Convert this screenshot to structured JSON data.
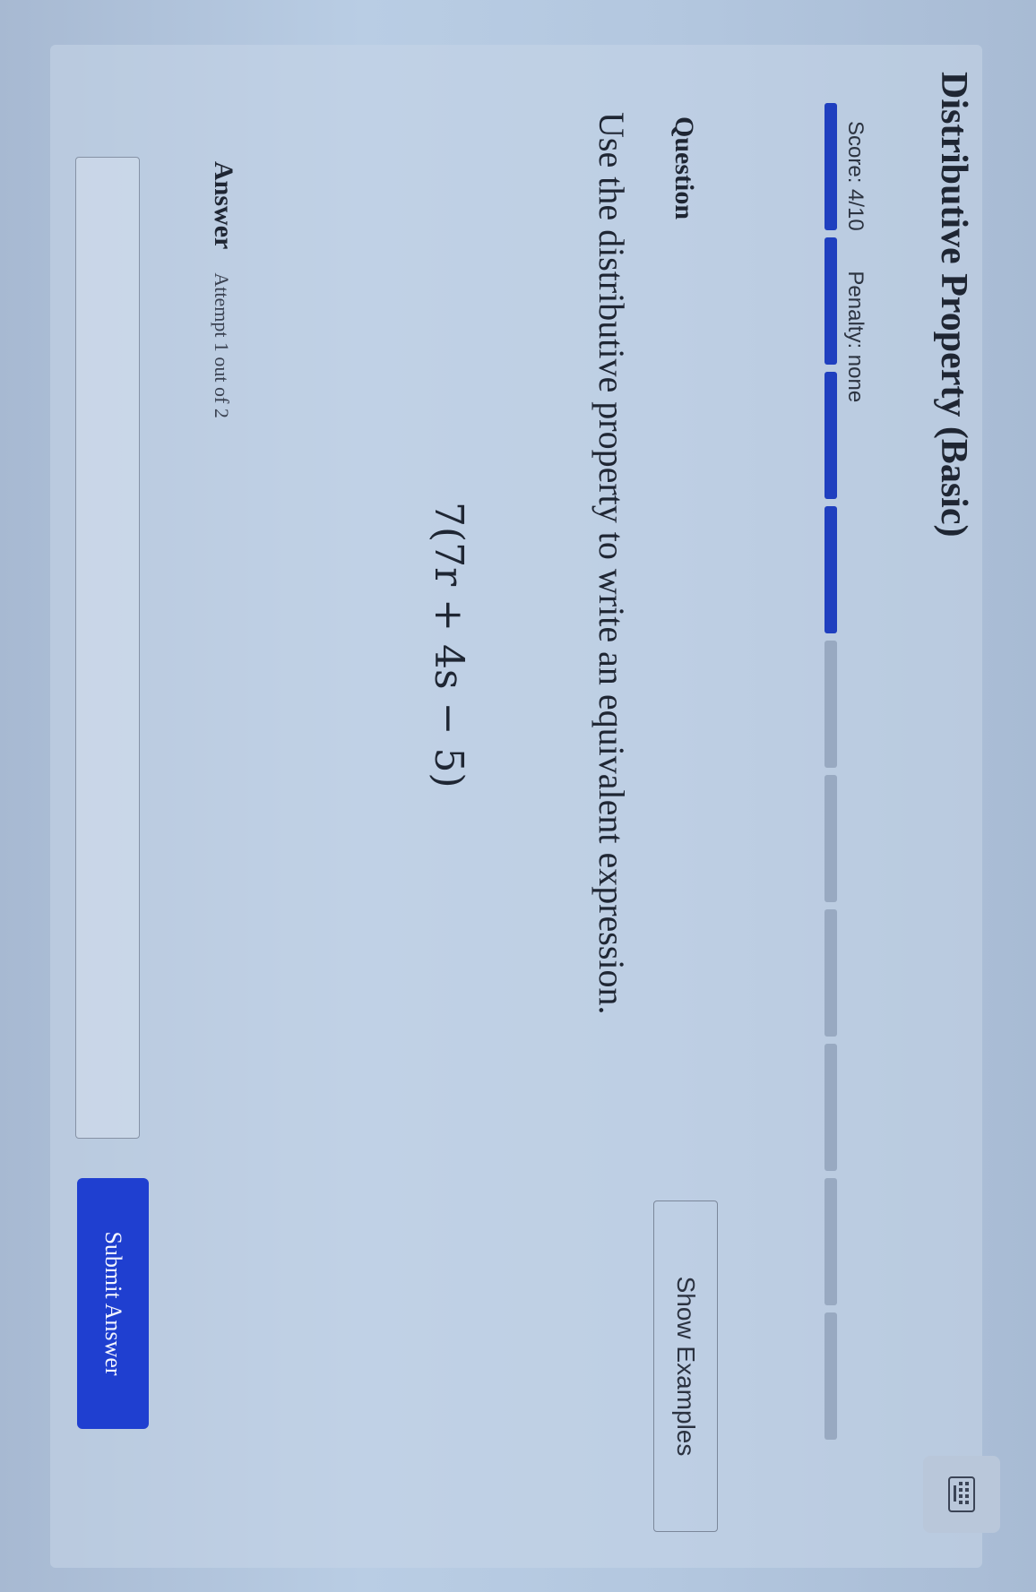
{
  "header": {
    "title": "Distributive Property (Basic)",
    "score": "Score: 4/10",
    "penalty": "Penalty: none"
  },
  "progress": {
    "completed": 4,
    "total": 10,
    "fill_color": "#1f3fbf",
    "empty_color": "#98a9c1"
  },
  "question": {
    "label": "Question",
    "show_examples_label": "Show Examples",
    "prompt": "Use the distributive property to write an equivalent expression.",
    "expression": "7(7r + 4s − 5)"
  },
  "answer": {
    "label": "Answer",
    "attempt": "Attempt 1 out of 2",
    "input_value": "",
    "submit_label": "Submit Answer",
    "keypad_icon": "keypad-icon"
  },
  "colors": {
    "accent": "#1f3fd0"
  }
}
